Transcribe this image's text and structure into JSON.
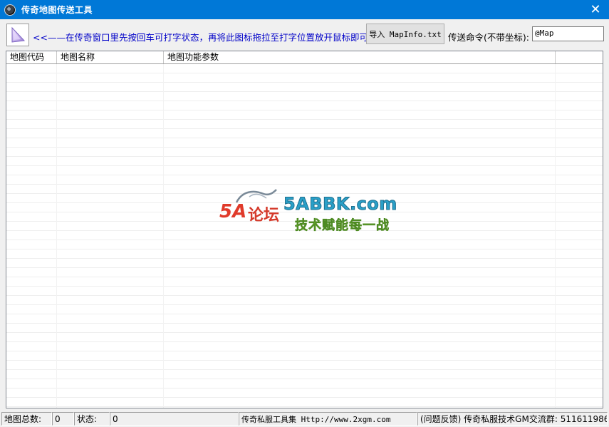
{
  "window": {
    "title": "传奇地图传送工具",
    "close_glyph": "✕"
  },
  "toolbar": {
    "hint": "<<——在传奇窗口里先按回车可打字状态，再将此图标拖拉至打字位置放开鼠标即可。",
    "import_button": "导入 MapInfo.txt",
    "command_label": "传送命令(不带坐标):",
    "command_value": "@Map"
  },
  "table": {
    "columns": [
      "地图代码",
      "地图名称",
      "地图功能参数"
    ]
  },
  "watermark": {
    "logo_5a": "5A",
    "logo_lt": "论坛",
    "site": "5ABBK.com",
    "slogan": "技术赋能每一战"
  },
  "statusbar": {
    "map_total_label": "地图总数:",
    "map_total_value": "0",
    "status_label": "状态:",
    "status_value": "0",
    "toolset": "传奇私服工具集 Http://www.2xgm.com",
    "feedback": "(问题反馈) 传奇私服技术GM交流群: 511611986"
  },
  "colors": {
    "titlebar": "#0078d7",
    "hint_text": "#0000c8"
  },
  "icons": [
    "app-icon",
    "close-icon",
    "drag-target-icon"
  ]
}
